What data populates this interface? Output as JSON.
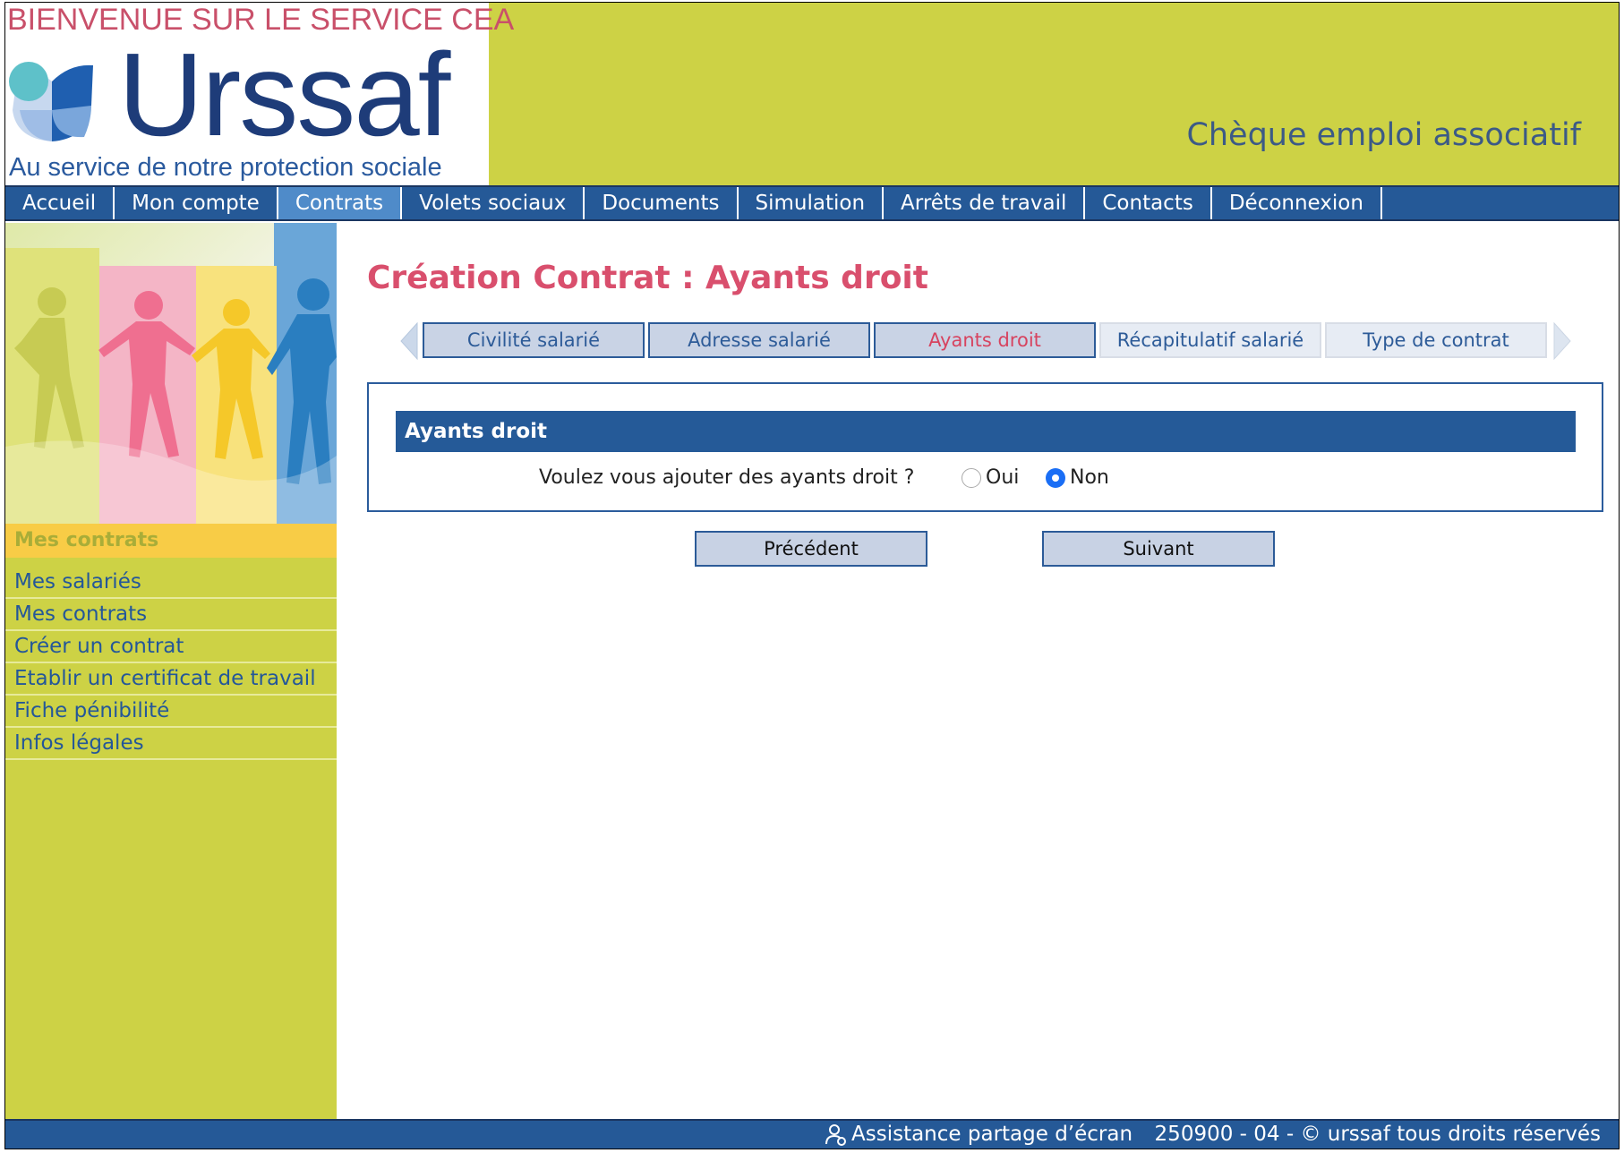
{
  "header": {
    "welcome": "BIENVENUE SUR LE SERVICE CEA",
    "brand": "Urssaf",
    "tagline": "Au service de notre protection sociale",
    "app_title": "Chèque emploi associatif"
  },
  "nav": {
    "items": [
      {
        "label": "Accueil"
      },
      {
        "label": "Mon compte"
      },
      {
        "label": "Contrats",
        "active": true
      },
      {
        "label": "Volets sociaux"
      },
      {
        "label": "Documents"
      },
      {
        "label": "Simulation"
      },
      {
        "label": "Arrêts de travail"
      },
      {
        "label": "Contacts"
      },
      {
        "label": "Déconnexion"
      }
    ]
  },
  "sidebar": {
    "section_title": "Mes contrats",
    "items": [
      {
        "label": "Mes salariés"
      },
      {
        "label": "Mes contrats"
      },
      {
        "label": "Créer un contrat"
      },
      {
        "label": "Etablir un certificat de travail"
      },
      {
        "label": "Fiche pénibilité"
      },
      {
        "label": "Infos légales"
      }
    ]
  },
  "main": {
    "title": "Création Contrat : Ayants droit",
    "steps": [
      {
        "label": "Civilité salarié",
        "state": "done"
      },
      {
        "label": "Adresse salarié",
        "state": "done"
      },
      {
        "label": "Ayants droit",
        "state": "current"
      },
      {
        "label": "Récapitulatif salarié",
        "state": "future"
      },
      {
        "label": "Type de contrat",
        "state": "future"
      }
    ],
    "panel": {
      "heading": "Ayants droit",
      "question": "Voulez vous ajouter des ayants droit ?",
      "options": [
        {
          "label": "Oui",
          "selected": false
        },
        {
          "label": "Non",
          "selected": true
        }
      ]
    },
    "buttons": {
      "previous": "Précédent",
      "next": "Suivant"
    }
  },
  "footer": {
    "assistance": "Assistance partage d’écran",
    "copyright": "250900 - 04 - © urssaf tous droits réservés"
  },
  "colors": {
    "header_bg": "#cdd245",
    "nav_bg": "#255997",
    "nav_active": "#4f8bc9",
    "title": "#d94f6d",
    "accent_yellow": "#f8cc46"
  }
}
